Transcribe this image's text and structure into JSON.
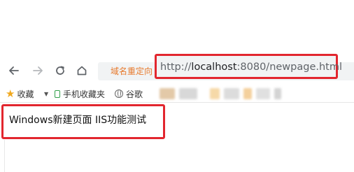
{
  "toolbar": {
    "back_icon": "back-arrow-icon",
    "forward_icon": "forward-arrow-icon",
    "reload_icon": "reload-icon",
    "home_icon": "home-icon"
  },
  "address_bar": {
    "redirect_tip": "域名重定向",
    "url_prefix": "http://",
    "url_host": "localhost",
    "url_rest": ":8080/newpage.html"
  },
  "bookmarks": {
    "favorites_label": "收藏",
    "mobile_label": "手机收藏夹",
    "google_label": "谷歌"
  },
  "page": {
    "content_text": "Windows新建页面 IIS功能测试"
  },
  "colors": {
    "highlight_border": "#e2262e",
    "redirect_tip": "#e77a2d",
    "star": "#f0a81e",
    "mobile_icon": "#31a04a"
  }
}
